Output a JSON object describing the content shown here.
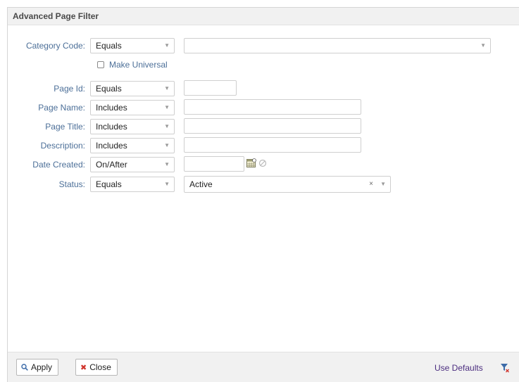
{
  "dialog": {
    "title": "Advanced Page Filter"
  },
  "rows": [
    {
      "label": "Category Code:",
      "operator": "Equals",
      "value": ""
    },
    {
      "label": "Page Id:",
      "operator": "Equals",
      "value": ""
    },
    {
      "label": "Page Name:",
      "operator": "Includes",
      "value": ""
    },
    {
      "label": "Page Title:",
      "operator": "Includes",
      "value": ""
    },
    {
      "label": "Description:",
      "operator": "Includes",
      "value": ""
    },
    {
      "label": "Date Created:",
      "operator": "On/After",
      "value": ""
    },
    {
      "label": "Status:",
      "operator": "Equals",
      "value": "Active"
    }
  ],
  "make_universal": {
    "label": "Make Universal",
    "checked": false
  },
  "icons": {
    "calendar": "calendar-icon",
    "clear_date": "clear-date-icon",
    "clear_status": "×",
    "dropdown": "▼"
  },
  "footer": {
    "apply_label": "Apply",
    "close_label": "Close",
    "use_defaults_label": "Use Defaults"
  },
  "colors": {
    "label": "#4c6f98",
    "link": "#4b2d7f",
    "close_icon": "#d0342c",
    "filter_icon": "#3b6aa8"
  }
}
